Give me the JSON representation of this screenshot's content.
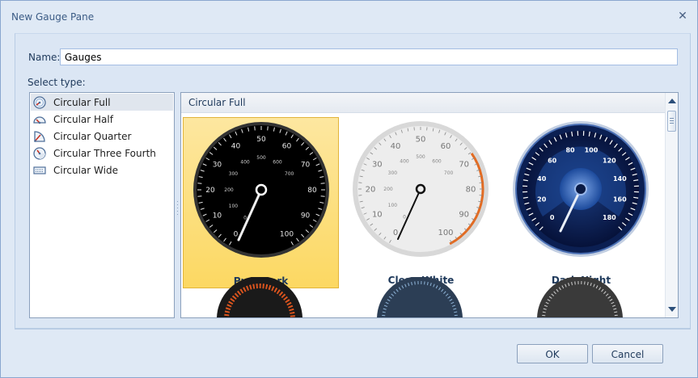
{
  "window": {
    "title": "New Gauge Pane",
    "close_glyph": "✕"
  },
  "name": {
    "label": "Name:",
    "value": "Gauges"
  },
  "select_label": "Select type:",
  "types": [
    {
      "label": "Circular Full",
      "icon": "circular-full-icon",
      "selected": true
    },
    {
      "label": "Circular Half",
      "icon": "circular-half-icon"
    },
    {
      "label": "Circular Quarter",
      "icon": "circular-quarter-icon"
    },
    {
      "label": "Circular Three Fourth",
      "icon": "circular-three-fourth-icon"
    },
    {
      "label": "Circular Wide",
      "icon": "circular-wide-icon"
    }
  ],
  "gallery": {
    "header": "Circular Full",
    "tiles": [
      {
        "label": "Pure Dark",
        "selected": true,
        "ticks": [
          "0",
          "10",
          "20",
          "30",
          "40",
          "50",
          "60",
          "70",
          "80",
          "90",
          "100"
        ],
        "inner_ticks": [
          "0",
          "100",
          "200",
          "300",
          "400",
          "500",
          "600",
          "700"
        ]
      },
      {
        "label": "Clean White",
        "ticks": [
          "0",
          "10",
          "20",
          "30",
          "40",
          "50",
          "60",
          "70",
          "80",
          "90",
          "100"
        ],
        "inner_ticks": [
          "0",
          "100",
          "200",
          "300",
          "400",
          "500",
          "600",
          "700"
        ]
      },
      {
        "label": "Dark Night",
        "ticks": [
          "0",
          "20",
          "40",
          "60",
          "80",
          "100",
          "120",
          "140",
          "160",
          "180"
        ]
      }
    ]
  },
  "buttons": {
    "ok": "OK",
    "cancel": "Cancel"
  },
  "colors": {
    "accent": "#1e395b",
    "selection": "#fcd862",
    "pure_dark_face": "#000000",
    "dark_night_face": "#0d1f4e",
    "clean_white_face": "#ededed",
    "warning_arc": "#e36b22"
  }
}
